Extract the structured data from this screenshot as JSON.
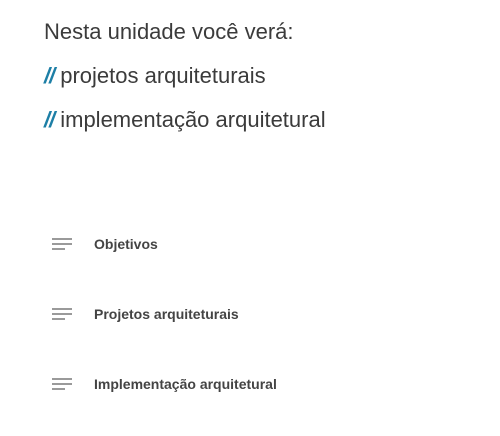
{
  "intro": {
    "heading": "Nesta unidade você verá:",
    "topics": [
      {
        "marker": "//",
        "text": "projetos arquiteturais"
      },
      {
        "marker": "//",
        "text": "implementação arquitetural"
      }
    ]
  },
  "lessons": [
    {
      "icon": "list-lines-icon",
      "label": "Objetivos"
    },
    {
      "icon": "list-lines-icon",
      "label": "Projetos arquiteturais"
    },
    {
      "icon": "list-lines-icon",
      "label": "Implementação arquitetural"
    }
  ],
  "colors": {
    "accent": "#1d7fa6",
    "text": "#3b3b3b",
    "icon": "#9a9a9a"
  }
}
